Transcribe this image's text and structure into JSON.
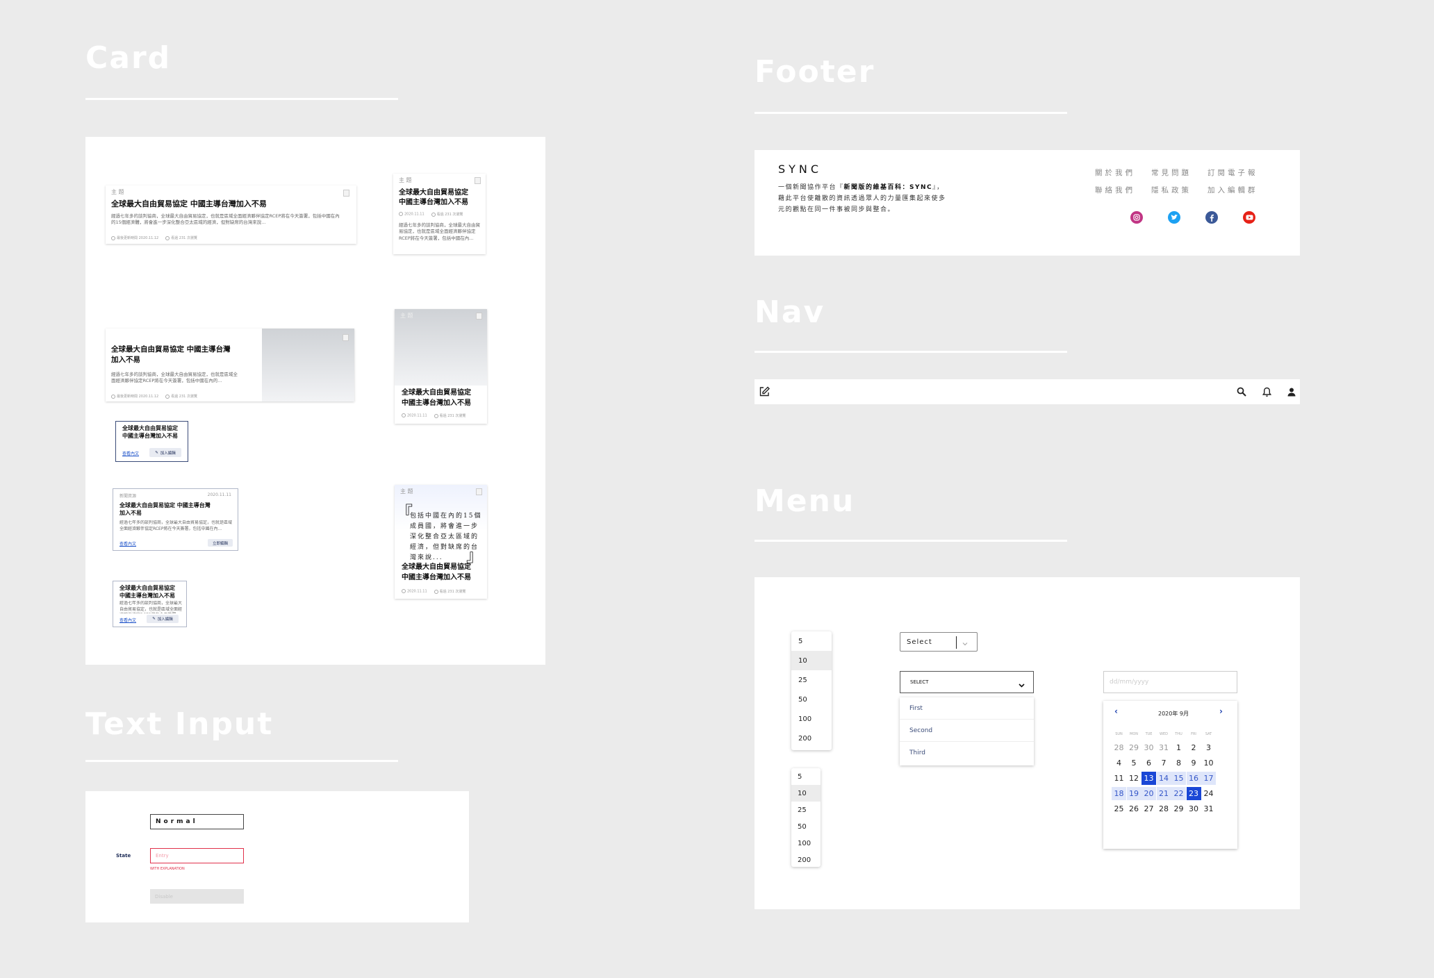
{
  "sections": {
    "card": "Card",
    "footer": "Footer",
    "nav": "Nav",
    "menu": "Menu",
    "text_input": "Text Input"
  },
  "cards": {
    "tag": "主 題",
    "title": "全球最大自由貿易協定 中國主導台灣加入不易",
    "title_l1": "全球最大自由貿易協定",
    "title_l2": "中國主導台灣加入不易",
    "title_wide_l1": "全球最大自由貿易協定 中國主導台灣",
    "title_wide_l2": "加入不易",
    "desc_wide": "經過七年多的談判協商，全球最大自由貿易協定，也就是區域全面經濟夥伴協定RCEP將在今天簽署，包括中國在內的15個經濟體，將會進一步深化整合亞太區域的經濟，但對缺席的台灣來說...",
    "desc_narrow": "經過七年多的談判協商，全球最大自由貿易協定，也就是區域全面經濟夥伴協定RCEP將在今天簽署，包括中國在內...",
    "desc_mid": "經過七年多的談判協商，全球最大自由貿易協定，也就是區域全面經濟夥伴協定RCEP將在今天簽署，包括中國在內的...",
    "desc_small": "經過七年多的談判協商，全球最大自由貿易協定，也就是區域全面經濟夥伴協定RCEP將在今天簽署，包括中國在內...",
    "meta_date_long": "最後更新時間 2020.11.12",
    "meta_date": "2020.11.11",
    "meta_views": "看過 231 次瀏覽",
    "link": "查看內文",
    "button": "加入編輯",
    "button_alt": "立即編輯",
    "mini_tag": "新聞資源",
    "mini_date": "2020.11.11",
    "quote_open": "『",
    "quote_close": "』",
    "quote_l1": "包括中國在內的15個",
    "quote_l2": "成員國，將會進一步",
    "quote_l3": "深化整合亞太區域的",
    "quote_l4": "經濟，但對缺席的台",
    "quote_l5": "灣來說..."
  },
  "footer": {
    "logo": "SYNC",
    "desc_l1_a": "一個新聞協作平台『",
    "desc_l1_b": "新聞版的維基百科：SYNC",
    "desc_l1_c": "』，",
    "desc_l2": "藉此平台使離散的資訊透過眾人的力量匯集起來使多",
    "desc_l3": "元的觀點在同一件事被同步與整合。",
    "links": [
      "關於我們",
      "常見問題",
      "訂閱電子報",
      "聯絡我們",
      "隱私政策",
      "加入編輯群"
    ],
    "social": {
      "instagram": "#c13584",
      "twitter": "#1da1f2",
      "facebook": "#3b5998",
      "youtube": "#e62117"
    }
  },
  "nav": {
    "icons": [
      "edit-icon",
      "search-icon",
      "bell-icon",
      "user-icon"
    ]
  },
  "menu": {
    "list_a": [
      "5",
      "10",
      "25",
      "50",
      "100",
      "200"
    ],
    "list_a_selected": "10",
    "list_b": [
      "5",
      "10",
      "25",
      "50",
      "100",
      "200"
    ],
    "list_b_selected": "10",
    "select_small": "Select",
    "select_large": "SELECT",
    "options": [
      "First",
      "Second",
      "Third"
    ],
    "date_placeholder": "dd/mm/yyyy",
    "calendar": {
      "month": "2020年 9月",
      "weekdays": [
        "SUN",
        "MON",
        "TUE",
        "WED",
        "THU",
        "FRI",
        "SAT"
      ],
      "weeks": [
        [
          "28",
          "29",
          "30",
          "31",
          "1",
          "2",
          "3"
        ],
        [
          "4",
          "5",
          "6",
          "7",
          "8",
          "9",
          "10"
        ],
        [
          "11",
          "12",
          "13",
          "14",
          "15",
          "16",
          "17"
        ],
        [
          "18",
          "19",
          "20",
          "21",
          "22",
          "23",
          "24"
        ],
        [
          "25",
          "26",
          "27",
          "28",
          "29",
          "30",
          "31"
        ]
      ],
      "range_start": "13",
      "range_end": "23",
      "accent": "#1a47d6"
    }
  },
  "text_input": {
    "normal_value": "Normal",
    "state_label": "State",
    "error_placeholder": "Entry",
    "error_message": "WITH EXPLANATION",
    "disabled_placeholder": "Disable",
    "error_color": "#e0304a"
  }
}
